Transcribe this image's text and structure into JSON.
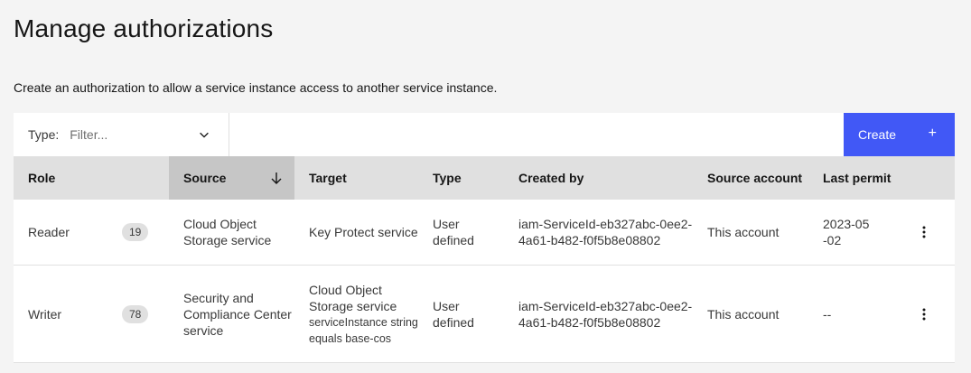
{
  "page": {
    "title": "Manage authorizations",
    "description": "Create an authorization to allow a service instance access to another service instance."
  },
  "toolbar": {
    "filter_label": "Type:",
    "filter_placeholder": "Filter...",
    "create_label": "Create",
    "create_icon": "+",
    "primary_color": "#4158f6"
  },
  "table": {
    "columns": [
      "Role",
      "Source",
      "Target",
      "Type",
      "Created by",
      "Source account",
      "Last permit"
    ],
    "sort_column": "Source",
    "rows": [
      {
        "role": "Reader",
        "count": "19",
        "source": "Cloud Object Storage service",
        "target": "Key Protect service",
        "target_detail": "",
        "type": "User defined",
        "created_by": "iam-ServiceId-eb327abc-0ee2-4a61-b482-f0f5b8e08802",
        "source_account": "This account",
        "last_permit": "2023-05-02"
      },
      {
        "role": "Writer",
        "count": "78",
        "source": "Security and Compliance Center service",
        "target": "Cloud Object Storage service",
        "target_detail": "serviceInstance string equals base-cos",
        "type": "User defined",
        "created_by": "iam-ServiceId-eb327abc-0ee2-4a61-b482-f0f5b8e08802",
        "source_account": "This account",
        "last_permit": "--"
      }
    ]
  }
}
